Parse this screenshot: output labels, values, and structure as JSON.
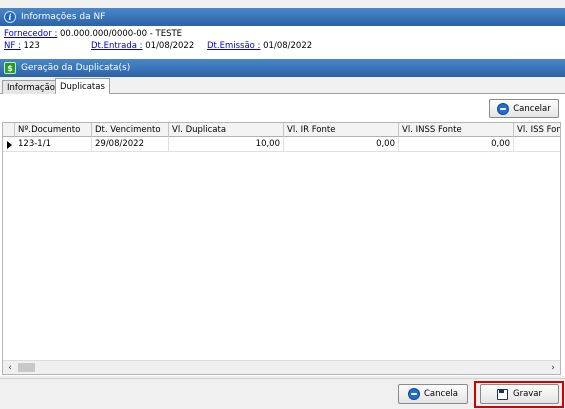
{
  "sections": {
    "nf_info_title": "Informações da NF",
    "duplicata_title": "Geração da Duplicata(s)"
  },
  "nf_info": {
    "fornecedor_label": "Fornecedor :",
    "fornecedor_value": " 00.000.000/0000-00 - TESTE",
    "nf_label": "NF :",
    "nf_value": " 123",
    "dt_entrada_label": "Dt.Entrada :",
    "dt_entrada_value": " 01/08/2022",
    "dt_emissao_label": "Dt.Emissão :",
    "dt_emissao_value": " 01/08/2022"
  },
  "tabs": [
    {
      "label": "Informação",
      "active": false
    },
    {
      "label": "Duplicatas",
      "active": true
    }
  ],
  "toolbar": {
    "cancelar_label": "Cancelar"
  },
  "grid": {
    "columns": [
      "Nº.Documento",
      "Dt. Vencimento",
      "Vl. Duplicata",
      "Vl. IR Fonte",
      "Vl. INSS Fonte",
      "Vl. ISS Font"
    ],
    "rows": [
      [
        "123-1/1",
        "29/08/2022",
        "10,00",
        "0,00",
        "0,00",
        ""
      ]
    ]
  },
  "scrollbar": {
    "left": "‹",
    "right": "›"
  },
  "footer": {
    "cancela_label": "Cancela",
    "gravar_label": "Gravar"
  },
  "colors": {
    "header_blue": "#2a63a6",
    "highlight_red": "#d40000",
    "link_blue": "#0000cc"
  }
}
